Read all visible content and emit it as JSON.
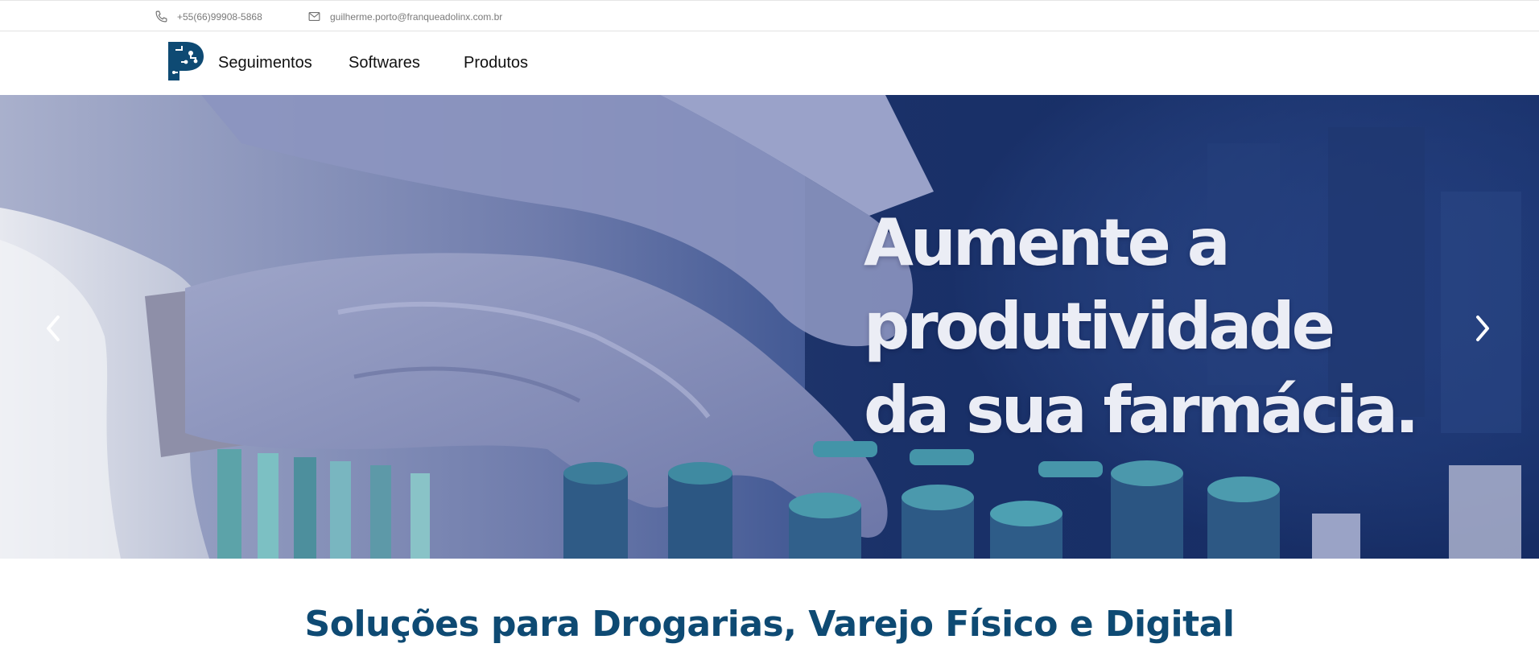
{
  "topbar": {
    "phone": {
      "icon": "phone-icon",
      "text": "+55(66)99908-5868"
    },
    "email": {
      "icon": "mail-icon",
      "text": "guilherme.porto@franqueadolinx.com.br"
    }
  },
  "navbar": {
    "logo": {
      "icon": "p-logo-icon",
      "color": "#0e4a73"
    },
    "items": [
      {
        "label": "Seguimentos"
      },
      {
        "label": "Softwares"
      },
      {
        "label": "Produtos"
      }
    ]
  },
  "hero": {
    "headline": [
      "Aumente a",
      "produtividade",
      "da sua farmácia."
    ],
    "prev_icon": "chevron-left-icon",
    "next_icon": "chevron-right-icon",
    "overlay_color": "#1f3a7a"
  },
  "section": {
    "title": "Soluções para Drogarias, Varejo Físico e Digital",
    "title_color": "#0e4a73"
  }
}
